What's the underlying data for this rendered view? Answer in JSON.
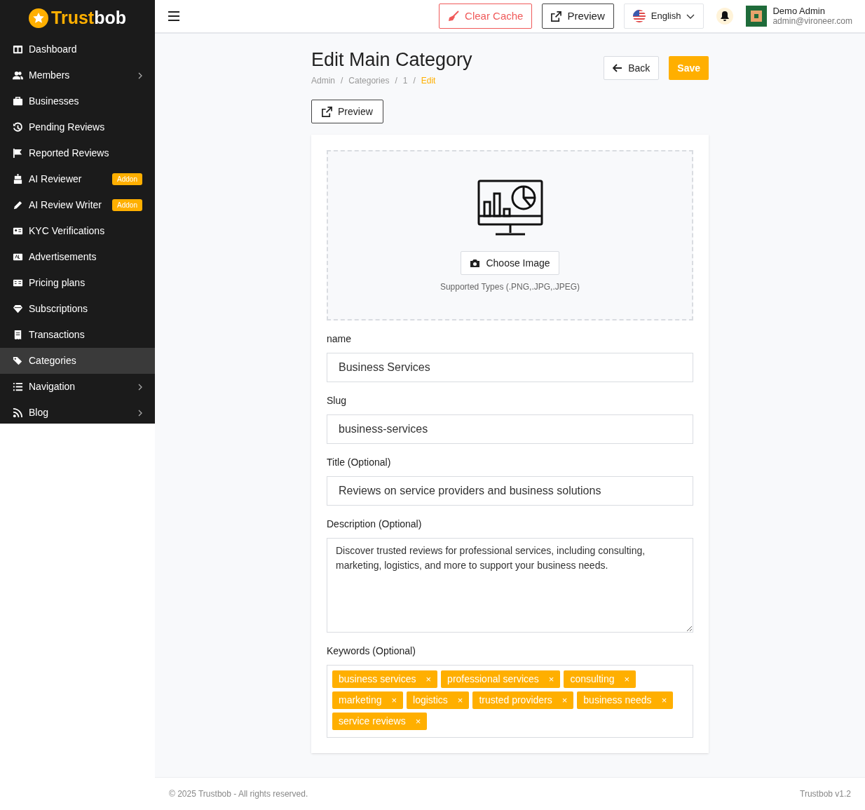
{
  "brand": {
    "part_1": "Trust",
    "part_2": "bob"
  },
  "sidebar": {
    "items": [
      {
        "label": "Dashboard",
        "selected": false
      },
      {
        "label": "Members",
        "chevron": true,
        "selected": false
      },
      {
        "label": "Businesses",
        "selected": false
      },
      {
        "label": "Pending Reviews",
        "selected": false
      },
      {
        "label": "Reported Reviews",
        "selected": false
      },
      {
        "label": "AI Reviewer",
        "badge": "Addon",
        "selected": false
      },
      {
        "label": "AI Review Writer",
        "badge": "Addon",
        "selected": false
      },
      {
        "label": "KYC Verifications",
        "selected": false
      },
      {
        "label": "Advertisements",
        "selected": false
      },
      {
        "label": "Pricing plans",
        "selected": false
      },
      {
        "label": "Subscriptions",
        "selected": false
      },
      {
        "label": "Transactions",
        "selected": false
      },
      {
        "label": "Categories",
        "selected": true
      },
      {
        "label": "Navigation",
        "chevron": true,
        "selected": false
      },
      {
        "label": "Blog",
        "chevron": true,
        "selected": false
      }
    ]
  },
  "header": {
    "clear_cache": "Clear Cache",
    "preview": "Preview",
    "language": "English",
    "user_name": "Demo Admin",
    "user_email": "admin@vironeer.com"
  },
  "page": {
    "title": "Edit Main Category",
    "breadcrumbs": [
      "Admin",
      "Categories",
      "1",
      "Edit"
    ],
    "breadcrumb_separator": "/",
    "back": "Back",
    "save": "Save",
    "preview": "Preview"
  },
  "form": {
    "choose_image": "Choose Image",
    "supported_types": "Supported Types (.PNG,.JPG,.JPEG)",
    "fields": [
      {
        "kind": "input",
        "label": "name",
        "value": "Business Services"
      },
      {
        "kind": "input",
        "label": "Slug",
        "value": "business-services"
      },
      {
        "kind": "input",
        "label": "Title (Optional)",
        "value": "Reviews on service providers and business solutions"
      },
      {
        "kind": "textarea",
        "label": "Description (Optional)",
        "value": "Discover trusted reviews for professional services, including consulting, marketing, logistics, and more to support your business needs."
      }
    ],
    "keywords_label": "Keywords (Optional)",
    "keywords": [
      "business services",
      "professional services",
      "consulting",
      "marketing",
      "logistics",
      "trusted providers",
      "business needs",
      "service reviews"
    ],
    "remove_mark": "×"
  },
  "footer": {
    "copyright": "© 2025 Trustbob - All rights reserved.",
    "version": "Trustbob v1.2"
  }
}
